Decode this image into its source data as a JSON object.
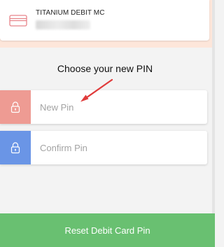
{
  "card": {
    "name": "TITANIUM DEBIT MC",
    "icon": "credit-card-icon",
    "accent_color": "#e8848a"
  },
  "prompt": "Choose your new PIN",
  "fields": {
    "new_pin": {
      "placeholder": "New Pin",
      "value": "",
      "icon": "lock-icon",
      "color": "#ee9b93"
    },
    "confirm_pin": {
      "placeholder": "Confirm Pin",
      "value": "",
      "icon": "lock-icon",
      "color": "#6a95e6"
    }
  },
  "annotation": {
    "icon": "arrow-icon",
    "color": "#e03b3b"
  },
  "reset_button": {
    "label": "Reset Debit Card Pin",
    "color": "#69c071"
  }
}
